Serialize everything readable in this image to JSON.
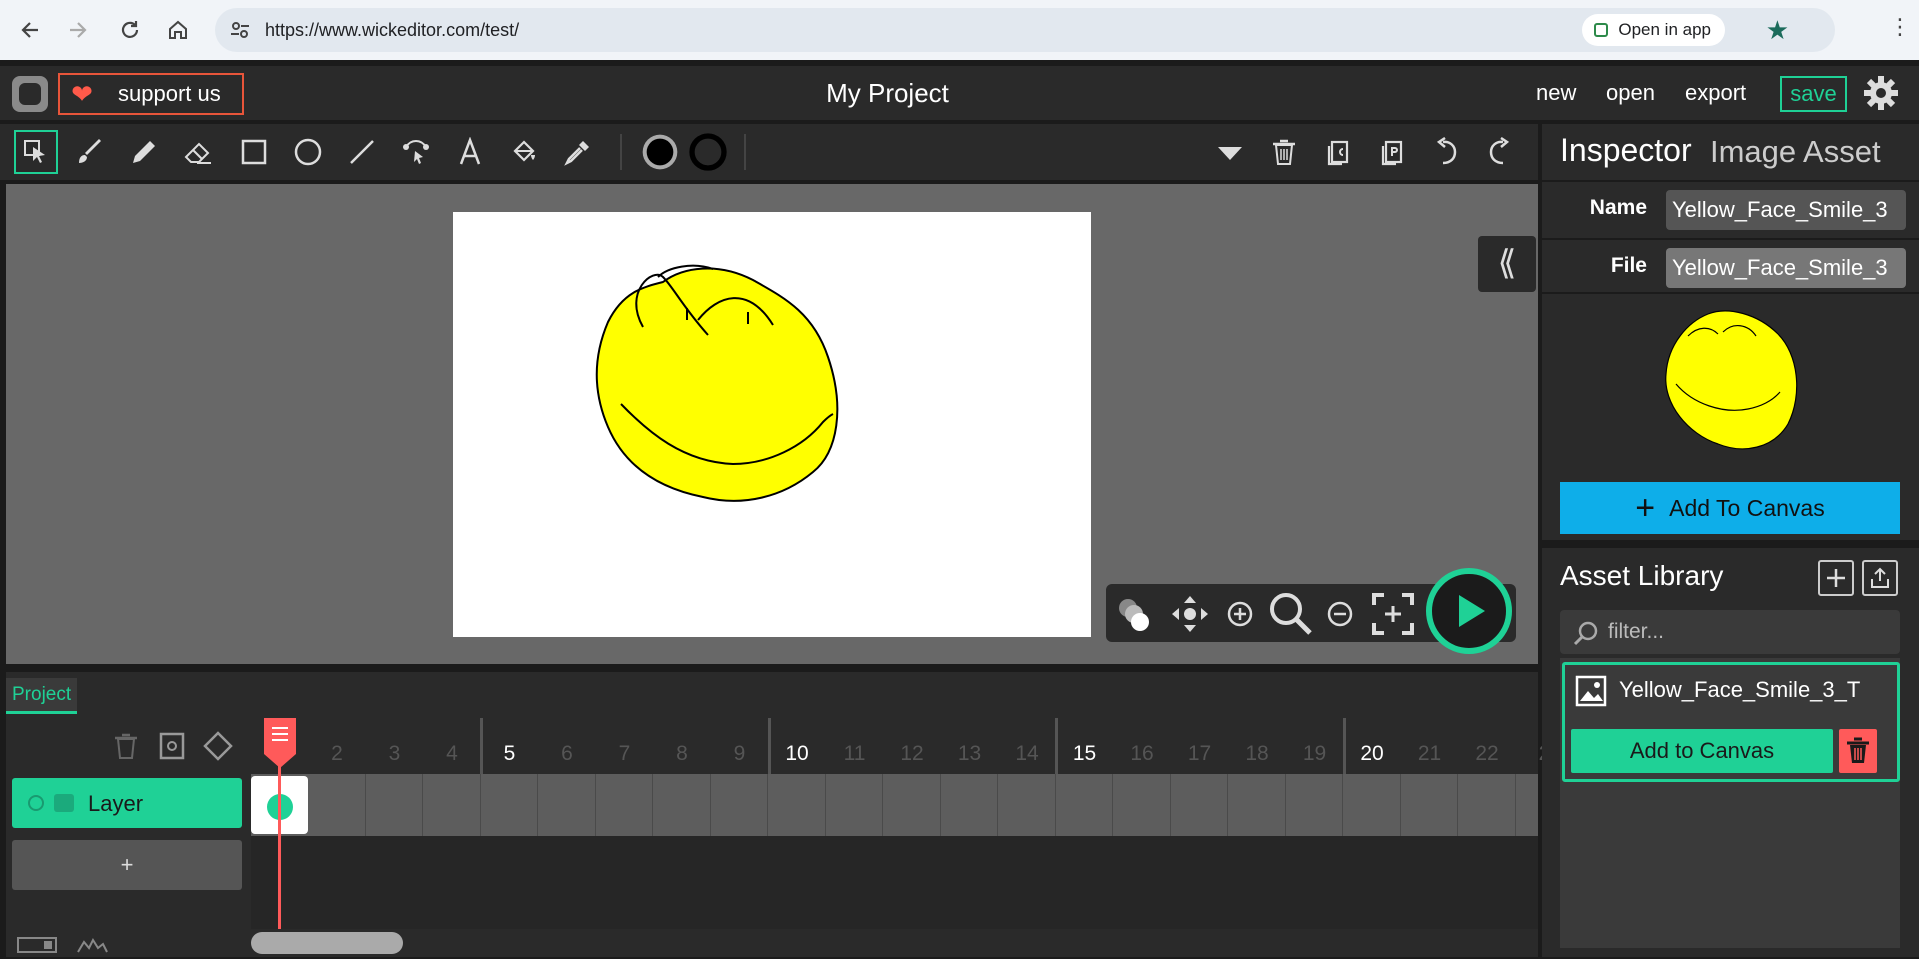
{
  "browser": {
    "url": "https://www.wickeditor.com/test/",
    "open_in_app_label": "Open in app"
  },
  "header": {
    "support_label": "support us",
    "project_title": "My Project",
    "menu": [
      "new",
      "open",
      "export"
    ],
    "save_label": "save"
  },
  "toolbar": {
    "tools": [
      "cursor-icon",
      "brush-icon",
      "pencil-icon",
      "eraser-icon",
      "rectangle-icon",
      "ellipse-icon",
      "line-icon",
      "path-icon",
      "text-icon",
      "fill-bucket-icon",
      "eyedropper-icon"
    ],
    "fill_color": "#000000",
    "stroke_color": "#000000"
  },
  "timeline": {
    "tab_label": "Project",
    "layer_name": "Layer",
    "add_layer_label": "+",
    "frame_numbers": [
      "1",
      "2",
      "3",
      "4",
      "5",
      "6",
      "7",
      "8",
      "9",
      "10",
      "11",
      "12",
      "13",
      "14",
      "15",
      "16",
      "17",
      "18",
      "19",
      "20",
      "21",
      "22",
      "2"
    ],
    "current_frame": 1
  },
  "inspector": {
    "title": "Inspector",
    "subtitle": "Image Asset",
    "name_label": "Name",
    "name_value": "Yellow_Face_Smile_3",
    "file_label": "File",
    "file_value": "Yellow_Face_Smile_3",
    "add_to_canvas_label": "Add To Canvas"
  },
  "asset_library": {
    "title": "Asset Library",
    "filter_placeholder": "filter...",
    "items": [
      {
        "name": "Yellow_Face_Smile_3_T",
        "add_label": "Add to Canvas"
      }
    ]
  },
  "colors": {
    "accent": "#1fd196",
    "danger": "#ff5a5a",
    "primary_blue": "#0eaee9",
    "face_fill": "#ffff00"
  }
}
